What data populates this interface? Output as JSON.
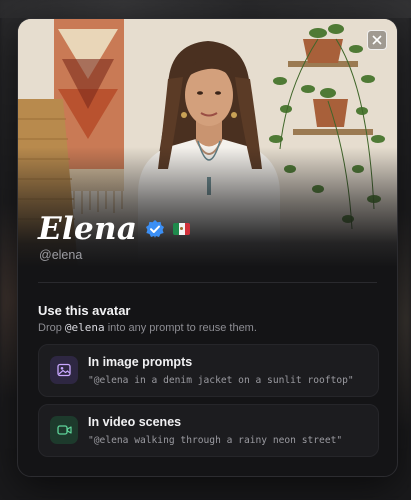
{
  "profile": {
    "name": "Elena",
    "handle": "@elena",
    "verified": true,
    "flag": "mexico-flag-icon"
  },
  "usage": {
    "title": "Use this avatar",
    "subtitle_prefix": "Drop",
    "subtitle_token": "@elena",
    "subtitle_suffix": "into any prompt to reuse them."
  },
  "options": [
    {
      "title": "In image prompts",
      "example": "\"@elena in a denim jacket on a sunlit rooftop\"",
      "icon": "image-icon",
      "accent": "#c9a8ff"
    },
    {
      "title": "In video scenes",
      "example": "\"@elena walking through a rainy neon street\"",
      "icon": "video-camera-icon",
      "accent": "#5fd49a"
    }
  ],
  "colors": {
    "verified_badge": "#3b8ff5",
    "modal_bg": "#141416"
  }
}
